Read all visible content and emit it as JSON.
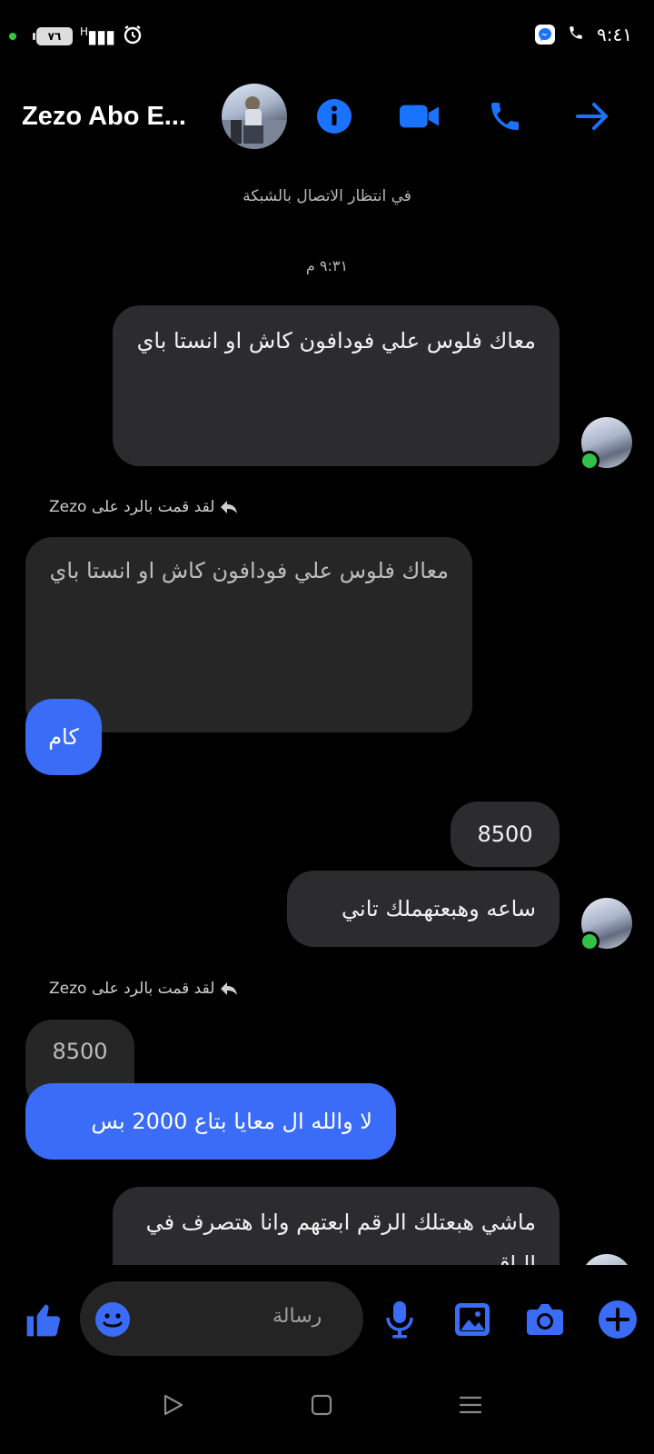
{
  "status_bar": {
    "battery": "٧٦",
    "signal": "H",
    "time": "٩:٤١"
  },
  "header": {
    "title": "Zezo Abo E...",
    "icons": [
      "info-icon",
      "video-call-icon",
      "phone-icon",
      "forward-arrow-icon"
    ]
  },
  "conversation": {
    "system_note": "في انتظار الاتصال بالشبكة",
    "timestamp": "٩:٣١ م",
    "messages": {
      "m1": "معاك فلوس علي فودافون كاش او انستا باي",
      "reply1_label": "لقد قمت بالرد على Zezo",
      "reply1_quote": "معاك فلوس علي فودافون كاش او انستا باي",
      "reply1_text": "كام",
      "m2": "8500",
      "m3": "ساعه وهبعتهملك تاني",
      "reply2_label": "لقد قمت بالرد على Zezo",
      "reply2_quote": "8500",
      "reply2_text": "لا والله ال معايا بتاع 2000 بس",
      "m4": "ماشي هبعتلك الرقم ابعتهم وانا هتصرف في الباقي"
    }
  },
  "composer": {
    "placeholder": "رسالة",
    "icons": [
      "like-icon",
      "emoji-icon",
      "mic-icon",
      "gallery-icon",
      "camera-icon",
      "plus-icon"
    ]
  },
  "colors": {
    "accent": "#3a6cf7",
    "icon_blue": "#1a73ff",
    "bubble_gray": "#2c2c2e",
    "online": "#31c24a"
  }
}
